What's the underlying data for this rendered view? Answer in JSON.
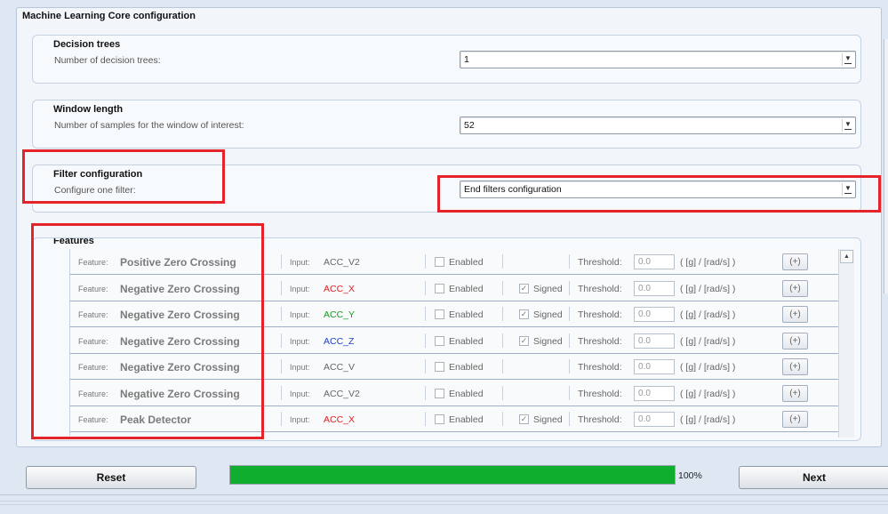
{
  "title": "Machine Learning Core configuration",
  "decision_trees": {
    "title": "Decision trees",
    "label": "Number of decision trees:",
    "value": "1"
  },
  "window_length": {
    "title": "Window length",
    "label": "Number of samples for the window of interest:",
    "value": "52"
  },
  "filter_config": {
    "title": "Filter configuration",
    "label": "Configure one filter:",
    "value": "End filters configuration"
  },
  "features": {
    "title": "Features",
    "feature_label": "Feature:",
    "input_label": "Input:",
    "enabled_label": "Enabled",
    "signed_label": "Signed",
    "threshold_label": "Threshold:",
    "unit_label": "( [g] / [rad/s] )",
    "plus_label": "(+)",
    "rows": [
      {
        "name": "Positive Zero Crossing",
        "input": "ACC_V2",
        "input_color": "#666666",
        "signed": false,
        "threshold": "0.0"
      },
      {
        "name": "Negative Zero Crossing",
        "input": "ACC_X",
        "input_color": "#e02020",
        "signed": true,
        "threshold": "0.0"
      },
      {
        "name": "Negative Zero Crossing",
        "input": "ACC_Y",
        "input_color": "#1a9a1a",
        "signed": true,
        "threshold": "0.0"
      },
      {
        "name": "Negative Zero Crossing",
        "input": "ACC_Z",
        "input_color": "#2040d0",
        "signed": true,
        "threshold": "0.0"
      },
      {
        "name": "Negative Zero Crossing",
        "input": "ACC_V",
        "input_color": "#666666",
        "signed": false,
        "threshold": "0.0"
      },
      {
        "name": "Negative Zero Crossing",
        "input": "ACC_V2",
        "input_color": "#666666",
        "signed": false,
        "threshold": "0.0"
      },
      {
        "name": "Peak Detector",
        "input": "ACC_X",
        "input_color": "#e02020",
        "signed": true,
        "threshold": "0.0"
      }
    ]
  },
  "footer": {
    "reset_label": "Reset",
    "next_label": "Next",
    "progress_percent": 100,
    "progress_text": "100%"
  },
  "colors": {
    "highlight": "#e3242b",
    "progress": "#0fae2e"
  }
}
